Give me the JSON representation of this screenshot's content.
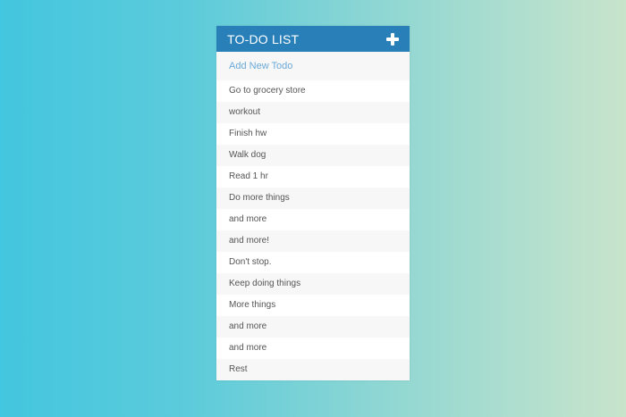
{
  "header": {
    "title": "TO-DO LIST",
    "add_icon": "plus-icon"
  },
  "new_todo": {
    "placeholder": "Add New Todo",
    "value": ""
  },
  "todos": [
    "Go to grocery store",
    "workout",
    "Finish hw",
    "Walk dog",
    "Read 1 hr",
    "Do more things",
    "and more",
    "and more!",
    "Don't stop.",
    "Keep doing things",
    "More things",
    "and more",
    "and more",
    "Rest"
  ],
  "colors": {
    "header_bg": "#2980b9",
    "gradient_start": "#43c6df",
    "gradient_end": "#c8e4cb"
  }
}
